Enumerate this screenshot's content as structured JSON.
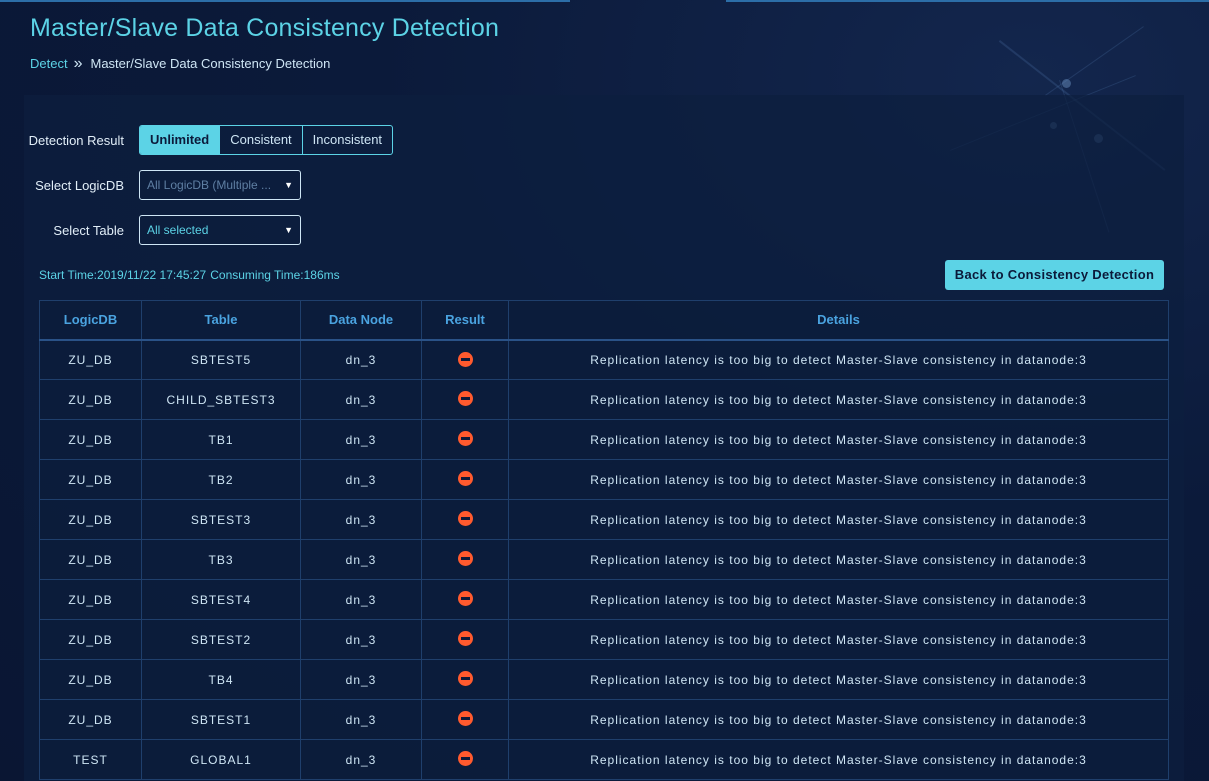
{
  "page": {
    "title": "Master/Slave Data Consistency Detection"
  },
  "breadcrumb": {
    "link": "Detect",
    "separator": "»",
    "current": "Master/Slave Data Consistency Detection"
  },
  "filters": {
    "detection_result": {
      "label": "Detection Result",
      "options": [
        "Unlimited",
        "Consistent",
        "Inconsistent"
      ],
      "selected": "Unlimited"
    },
    "logicdb": {
      "label": "Select LogicDB",
      "placeholder": "All LogicDB (Multiple ..."
    },
    "table": {
      "label": "Select Table",
      "value": "All selected"
    }
  },
  "run_info": {
    "start_time": "Start Time:2019/11/22 17:45:27",
    "consuming_time": "Consuming Time:186ms"
  },
  "actions": {
    "back_label": "Back to Consistency Detection"
  },
  "results_table": {
    "headers": [
      "LogicDB",
      "Table",
      "Data Node",
      "Result",
      "Details"
    ],
    "rows": [
      {
        "logicdb": "ZU_DB",
        "table": "SBTEST5",
        "node": "dn_3",
        "result_icon": "no-entry-icon",
        "details": "Replication latency is too big to detect Master-Slave consistency in datanode:3"
      },
      {
        "logicdb": "ZU_DB",
        "table": "CHILD_SBTEST3",
        "node": "dn_3",
        "result_icon": "no-entry-icon",
        "details": "Replication latency is too big to detect Master-Slave consistency in datanode:3"
      },
      {
        "logicdb": "ZU_DB",
        "table": "TB1",
        "node": "dn_3",
        "result_icon": "no-entry-icon",
        "details": "Replication latency is too big to detect Master-Slave consistency in datanode:3"
      },
      {
        "logicdb": "ZU_DB",
        "table": "TB2",
        "node": "dn_3",
        "result_icon": "no-entry-icon",
        "details": "Replication latency is too big to detect Master-Slave consistency in datanode:3"
      },
      {
        "logicdb": "ZU_DB",
        "table": "SBTEST3",
        "node": "dn_3",
        "result_icon": "no-entry-icon",
        "details": "Replication latency is too big to detect Master-Slave consistency in datanode:3"
      },
      {
        "logicdb": "ZU_DB",
        "table": "TB3",
        "node": "dn_3",
        "result_icon": "no-entry-icon",
        "details": "Replication latency is too big to detect Master-Slave consistency in datanode:3"
      },
      {
        "logicdb": "ZU_DB",
        "table": "SBTEST4",
        "node": "dn_3",
        "result_icon": "no-entry-icon",
        "details": "Replication latency is too big to detect Master-Slave consistency in datanode:3"
      },
      {
        "logicdb": "ZU_DB",
        "table": "SBTEST2",
        "node": "dn_3",
        "result_icon": "no-entry-icon",
        "details": "Replication latency is too big to detect Master-Slave consistency in datanode:3"
      },
      {
        "logicdb": "ZU_DB",
        "table": "TB4",
        "node": "dn_3",
        "result_icon": "no-entry-icon",
        "details": "Replication latency is too big to detect Master-Slave consistency in datanode:3"
      },
      {
        "logicdb": "ZU_DB",
        "table": "SBTEST1",
        "node": "dn_3",
        "result_icon": "no-entry-icon",
        "details": "Replication latency is too big to detect Master-Slave consistency in datanode:3"
      },
      {
        "logicdb": "TEST",
        "table": "GLOBAL1",
        "node": "dn_3",
        "result_icon": "no-entry-icon",
        "details": "Replication latency is too big to detect Master-Slave consistency in datanode:3"
      }
    ]
  },
  "colors": {
    "accent": "#5cd3e6",
    "background": "#0b1a3a",
    "header_text": "#4aa3e0",
    "error": "#ff5a2e"
  }
}
